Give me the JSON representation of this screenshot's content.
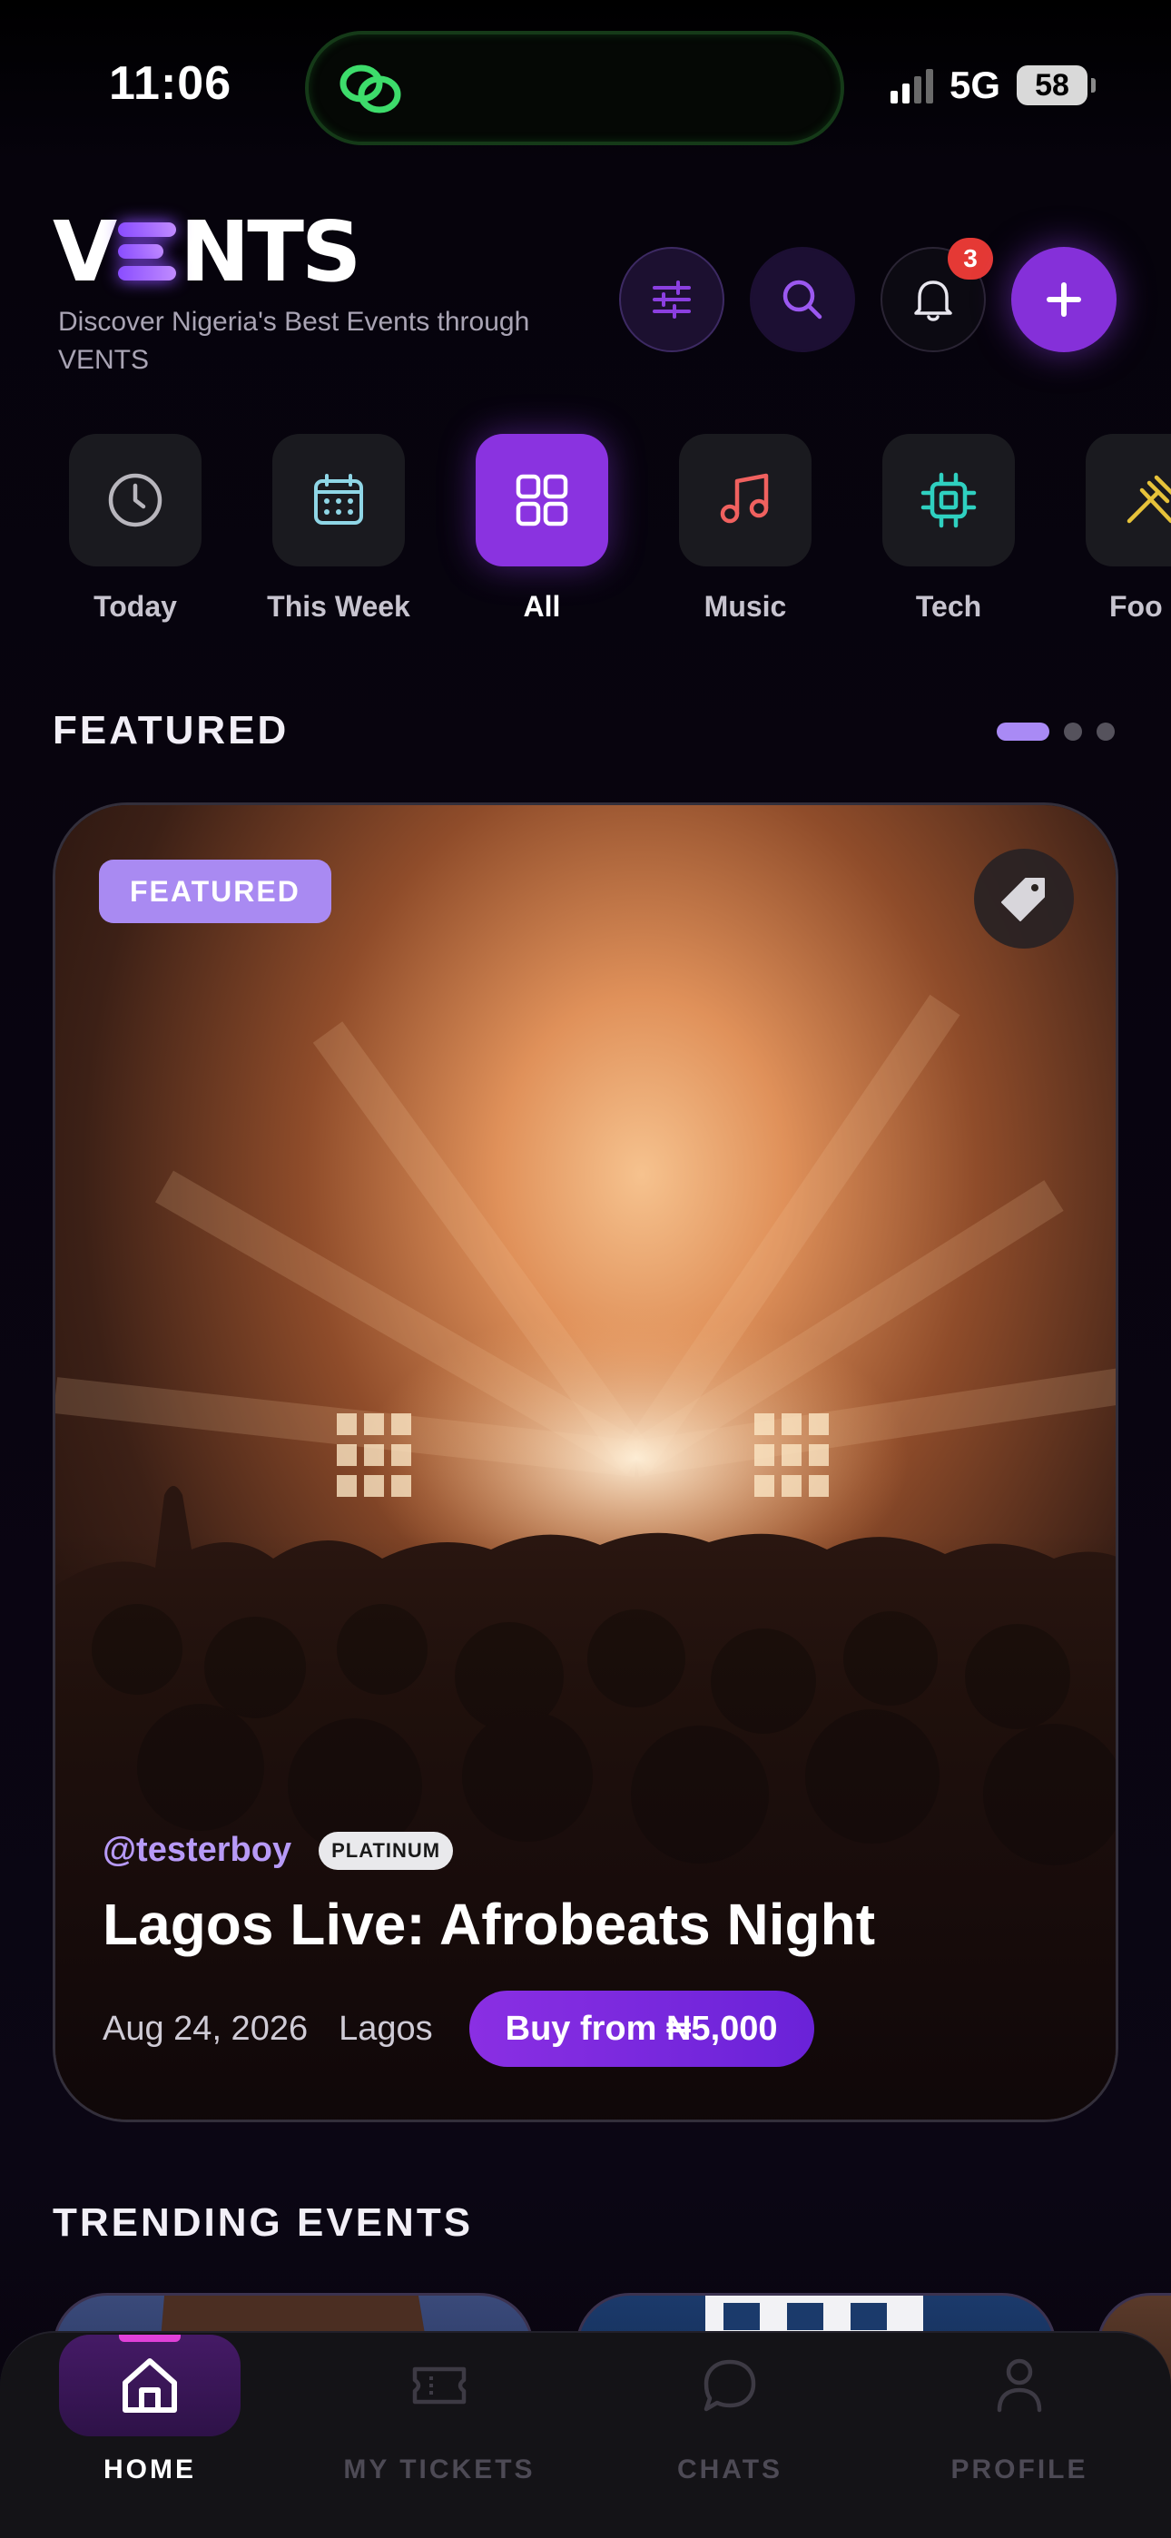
{
  "status_bar": {
    "time": "11:06",
    "network": "5G",
    "battery": "58"
  },
  "header": {
    "logo_text_start": "V",
    "logo_text_end": "NTS",
    "tagline": "Discover Nigeria's Best Events through VENTS",
    "notification_count": "3"
  },
  "categories": [
    {
      "label": "Today",
      "icon": "clock-icon"
    },
    {
      "label": "This Week",
      "icon": "calendar-icon"
    },
    {
      "label": "All",
      "icon": "grid-icon",
      "active": true
    },
    {
      "label": "Music",
      "icon": "music-note-icon"
    },
    {
      "label": "Tech",
      "icon": "chip-icon"
    },
    {
      "label": "Foo",
      "icon": "utensils-icon"
    }
  ],
  "featured": {
    "section_title": "FEATURED",
    "carousel_pages": 3,
    "carousel_active": 1,
    "card": {
      "badge": "FEATURED",
      "organizer": "@testerboy",
      "organizer_tier": "PLATINUM",
      "title": "Lagos Live: Afrobeats Night",
      "date": "Aug 24, 2026",
      "city": "Lagos",
      "buy_label": "Buy from ₦5,000"
    }
  },
  "trending": {
    "section_title": "TRENDING EVENTS"
  },
  "bottom_nav": [
    {
      "label": "HOME",
      "icon": "home-icon",
      "active": true
    },
    {
      "label": "MY TICKETS",
      "icon": "ticket-icon"
    },
    {
      "label": "CHATS",
      "icon": "chat-bubble-icon"
    },
    {
      "label": "PROFILE",
      "icon": "user-icon"
    }
  ],
  "colors": {
    "accent": "#8530d9",
    "accent_light": "#a98af2",
    "background": "#07040c",
    "badge_red": "#e53935"
  }
}
